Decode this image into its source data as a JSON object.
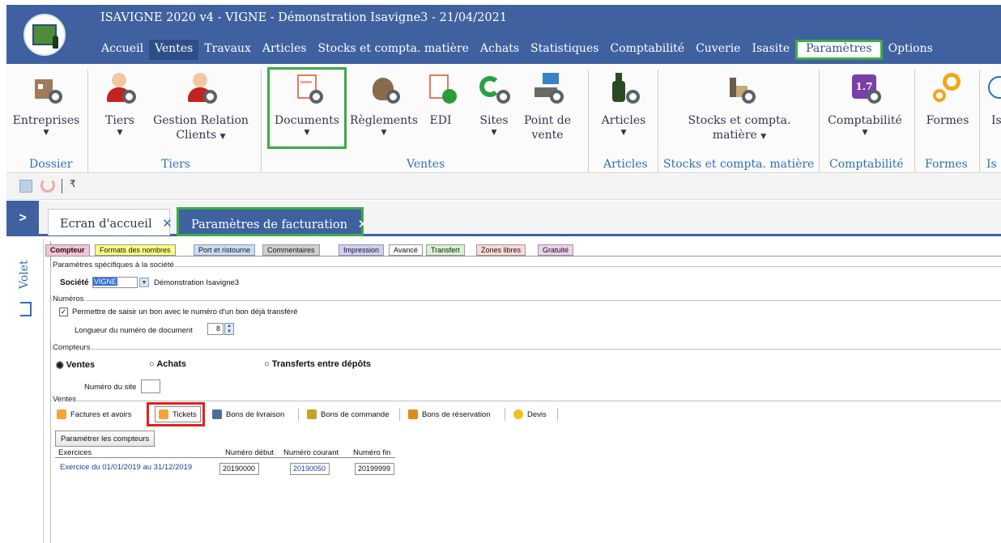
{
  "app": {
    "title": "ISAVIGNE 2020 v4 - VIGNE - Démonstration Isavigne3 - 21/04/2021"
  },
  "menu": [
    "Accueil",
    "Ventes",
    "Travaux",
    "Articles",
    "Stocks et compta. matière",
    "Achats",
    "Statistiques",
    "Comptabilité",
    "Cuverie",
    "Isasite",
    "Paramètres",
    "Options"
  ],
  "ribbon": {
    "buttons": {
      "entreprises": "Entreprises",
      "tiers": "Tiers",
      "grc1": "Gestion Relation",
      "grc2": "Clients",
      "documents": "Documents",
      "reglements": "Règlements",
      "edi": "EDI",
      "sites": "Sites",
      "pdv1": "Point de",
      "pdv2": "vente",
      "articles": "Articles",
      "stocks1": "Stocks et compta.",
      "stocks2": "matière",
      "compta": "Comptabilité",
      "formes": "Formes",
      "is": "Is",
      "compta_icon_text": "1.7"
    },
    "groups": {
      "dossier": "Dossier",
      "tiers": "Tiers",
      "ventes": "Ventes",
      "articles": "Articles",
      "stocks": "Stocks et compta. matière",
      "comptabilite": "Comptabilité",
      "formes": "Formes",
      "is": "Is"
    }
  },
  "tabs": {
    "home": "Ecran d'accueil",
    "billing": "Paramètres de facturation",
    "close": "✕"
  },
  "volet": {
    "label": "Volet"
  },
  "subtabs": [
    "Compteur",
    "Formats des nombres",
    "Port et ristourne",
    "Commentaires",
    "Impression",
    "Avancé",
    "Transfert",
    "Zones libres",
    "Gratuité"
  ],
  "societe": {
    "legend": "Paramètres spécifiques à la société",
    "label": "Société",
    "code": "VIGNE",
    "name": "Démonstration Isavigne3"
  },
  "numeros": {
    "legend": "Numéros",
    "checkbox_label": "Permettre de saisir un bon avec le numéro d'un bon déjà transféré",
    "length_label": "Longueur du numéro de document",
    "length_value": "8"
  },
  "compteurs": {
    "legend": "Compteurs",
    "radio_ventes": "Ventes",
    "radio_achats": "Achats",
    "radio_transferts": "Transferts entre dépôts",
    "site_label": "Numéro du site",
    "site_value": ""
  },
  "ventes": {
    "legend": "Ventes",
    "doc_tabs": [
      "Factures et avoirs",
      "Tickets",
      "Bons de livraison",
      "Bons de commande",
      "Bons de réservation",
      "Devis"
    ],
    "settings_button": "Paramétrer les compteurs",
    "table": {
      "headers": [
        "Exercices",
        "Numéro début",
        "Numéro courant",
        "Numéro fin"
      ],
      "rows": [
        [
          "Exercice du 01/01/2019 au 31/12/2019",
          "20190000",
          "20190050",
          "20199999"
        ]
      ]
    }
  },
  "colors": {
    "header": "#3f61a0",
    "highlight_green": "#3dab47",
    "highlight_red": "#e02020",
    "accent_text": "#2f6fb6"
  }
}
